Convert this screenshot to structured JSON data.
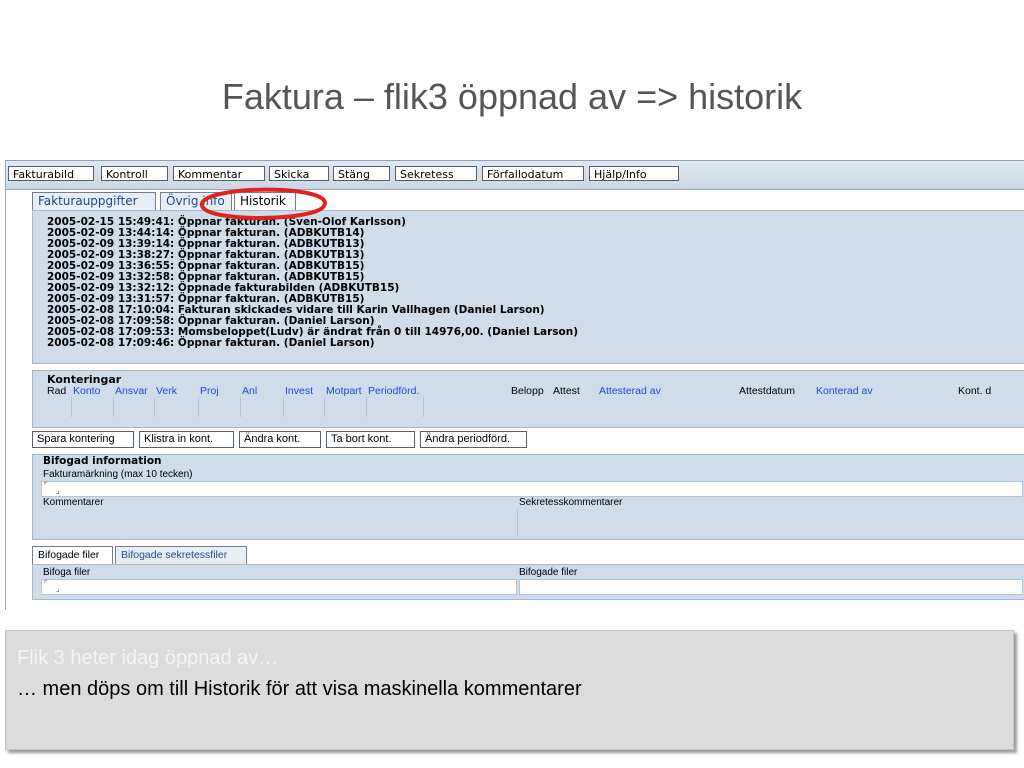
{
  "slide": {
    "title": "Faktura – flik3 öppnad av => historik"
  },
  "toolbar": {
    "buttons": [
      "Fakturabild",
      "Kontroll",
      "Kommentar",
      "Skicka",
      "Stäng",
      "Sekretess",
      "Förfallodatum",
      "Hjälp/Info"
    ]
  },
  "tabs": {
    "items": [
      "Fakturauppgifter",
      "Övrig info",
      "Historik"
    ],
    "active": "Historik"
  },
  "history": {
    "lines": [
      "2005-02-15 15:49:41: Öppnar fakturan. (Sven-Olof Karlsson)",
      "2005-02-09 13:44:14: Öppnar fakturan. (ADBKUTB14)",
      "2005-02-09 13:39:14: Öppnar fakturan. (ADBKUTB13)",
      "2005-02-09 13:38:27: Öppnar fakturan. (ADBKUTB13)",
      "2005-02-09 13:36:55: Öppnar fakturan. (ADBKUTB15)",
      "2005-02-09 13:32:58: Öppnar fakturan. (ADBKUTB15)",
      "2005-02-09 13:32:12: Öppnade fakturabilden (ADBKUTB15)",
      "2005-02-09 13:31:57: Öppnar fakturan. (ADBKUTB15)",
      "2005-02-08 17:10:04: Fakturan skickades vidare till Karin Vallhagen (Daniel Larson)",
      "2005-02-08 17:09:58: Öppnar fakturan. (Daniel Larson)",
      "2005-02-08 17:09:53: Momsbeloppet(Ludv) är ändrat från 0 till 14976,00. (Daniel Larson)",
      "2005-02-08 17:09:46: Öppnar fakturan. (Daniel Larson)"
    ]
  },
  "konteringar": {
    "title": "Konteringar",
    "columns": [
      "Rad",
      "Konto",
      "Ansvar",
      "Verk",
      "Proj",
      "Anl",
      "Invest",
      "Motpart",
      "Periodförd.",
      "Belopp",
      "Attest",
      "Attesterad av",
      "Attestdatum",
      "Konterad av",
      "Kont. d"
    ]
  },
  "kontering_buttons": [
    "Spara kontering",
    "Klistra in kont.",
    "Ändra kont.",
    "Ta bort kont.",
    "Ändra periodförd."
  ],
  "bifogad": {
    "title": "Bifogad information",
    "fakturamarkning_label": "Fakturamärkning (max 10 tecken)",
    "kommentarer_label": "Kommentarer",
    "sekretess_label": "Sekretesskommentarer"
  },
  "file_tabs": {
    "items": [
      "Bifogade filer",
      "Bifogade sekretessfiler"
    ],
    "active": "Bifogade filer"
  },
  "files": {
    "bifoga_label": "Bifoga filer",
    "bifogade_label": "Bifogade filer"
  },
  "notes": {
    "line1": "Flik 3 heter idag öppnad av…",
    "line2": "… men döps om till Historik för att visa maskinella kommentarer"
  },
  "colors": {
    "annotation_ellipse": "#e0231c",
    "panel_bg": "#cfdcea",
    "link_blue": "#1c4bd6"
  }
}
